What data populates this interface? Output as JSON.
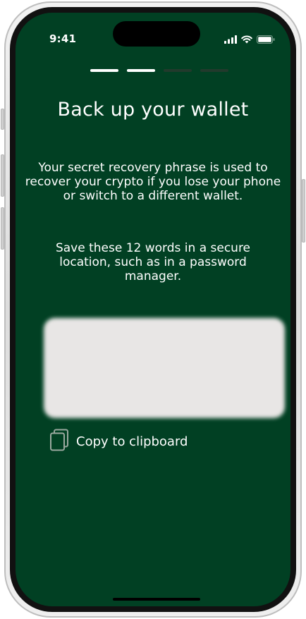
{
  "status_bar": {
    "time": "9:41",
    "icons": [
      "cellular-signal-icon",
      "wifi-icon",
      "battery-icon"
    ]
  },
  "progress": {
    "total_steps": 4,
    "current_step": 2
  },
  "screen": {
    "title": "Back up your wallet",
    "description": "Your secret recovery phrase is used to recover your crypto if you lose your phone or switch to a different wallet.",
    "instruction": "Save these 12 words in a secure location, such as in a password manager.",
    "copy_label": "Copy to clipboard",
    "copy_icon": "copy-icon"
  },
  "colors": {
    "background": "#014023",
    "text": "#ffffff",
    "phrase_box": "#e8e6e5",
    "step_active": "#ffffff",
    "step_inactive": "#223a2c"
  }
}
